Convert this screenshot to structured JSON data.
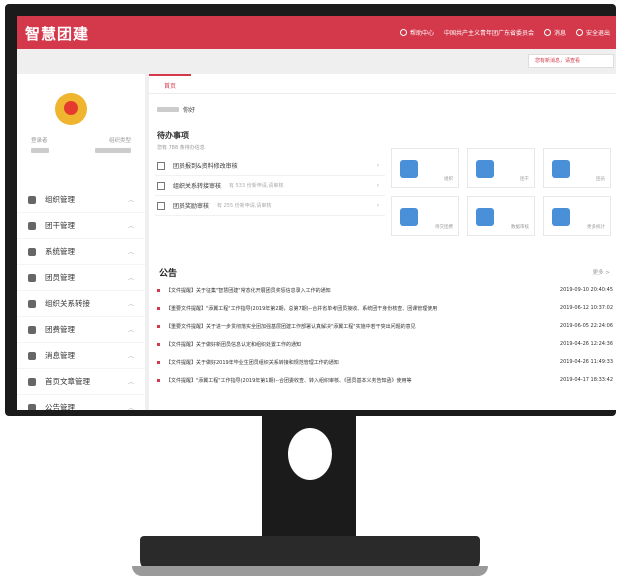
{
  "header": {
    "logo": "智慧团建",
    "nav": {
      "help": "帮助中心",
      "org": "中国共产主义青年团广东省委员会",
      "messages": "消息",
      "logout": "安全退出"
    },
    "notification": "您有新消息，请查看"
  },
  "sidebar": {
    "user_labels": [
      "登录者",
      "组织类型"
    ],
    "items": [
      {
        "label": "组织管理",
        "icon": "org-icon"
      },
      {
        "label": "团干管理",
        "icon": "cadre-icon"
      },
      {
        "label": "系统管理",
        "icon": "system-icon"
      },
      {
        "label": "团员管理",
        "icon": "member-icon"
      },
      {
        "label": "组织关系转接",
        "icon": "transfer-icon"
      },
      {
        "label": "团费管理",
        "icon": "fee-icon"
      },
      {
        "label": "消息管理",
        "icon": "message-icon"
      },
      {
        "label": "首页文章管理",
        "icon": "article-icon"
      },
      {
        "label": "公告管理",
        "icon": "notice-icon"
      }
    ]
  },
  "main": {
    "tab": "首页",
    "greeting": "你好",
    "todo": {
      "title": "待办事项",
      "count": "您有 788 条待办信息",
      "items": [
        {
          "label": "团员报到&资料修改审核",
          "sub": ""
        },
        {
          "label": "组织关系转接审核",
          "sub": "有 533 份新申请,请审核"
        },
        {
          "label": "团员奖励审核",
          "sub": "有 255 份新申请,请审核"
        }
      ]
    },
    "cards": [
      {
        "label": "组织"
      },
      {
        "label": "团干"
      },
      {
        "label": "团员"
      },
      {
        "label": "待交团费"
      },
      {
        "label": "数据审核"
      },
      {
        "label": "更多统计"
      }
    ],
    "announcements": {
      "title": "公告",
      "more": "更多 >",
      "rows": [
        {
          "text": "【文件提醒】关于征集\"智慧团建\"常态化开展团员奖惩信息录入工作的通知",
          "date": "2019-09-10 20:40:45"
        },
        {
          "text": "【重要文件提醒】\"添翼工程\"工作指导(2019年第2期，总第7期)--合并省单考团员接收、系统团干身份核查、团课管理使用",
          "date": "2019-06-12 10:37:02"
        },
        {
          "text": "【重要文件提醒】关于进一步贯彻落实全团加强基层团建工作部署认真解决\"添翼工程\"实施中若干突出问题的意见",
          "date": "2019-06-05 22:24:06"
        },
        {
          "text": "【文件提醒】关于做好新团员信息认定和组织处置工作的通知",
          "date": "2019-04-26 12:24:36"
        },
        {
          "text": "【文件提醒】关于做好2019年毕业生团员组织关系转接和规范管理工作的通知",
          "date": "2019-04-26 11:49:33"
        },
        {
          "text": "【文件提醒】\"添翼工程\"工作指导(2019年第1期)--合团委收查、转入组织审核、《团员基本义务告知函》使用等",
          "date": "2019-04-17 18:33:42"
        }
      ]
    }
  },
  "colors": {
    "brand": "#d4384b",
    "card_icon": "#4a90d9"
  }
}
